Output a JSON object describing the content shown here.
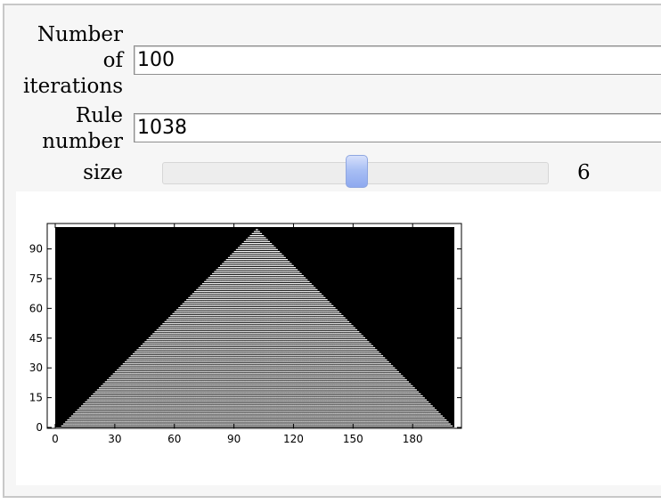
{
  "controls": {
    "iterations": {
      "label_lines": [
        "Number",
        "of",
        "iterations"
      ],
      "value": "100"
    },
    "rule": {
      "label_lines": [
        "Rule",
        "number"
      ],
      "value": "1038"
    },
    "size": {
      "label": "size",
      "value": "6",
      "level": 0.5
    }
  },
  "plot": {
    "x_ticks": [
      "0",
      "30",
      "60",
      "90",
      "120",
      "150",
      "180"
    ],
    "y_ticks": [
      "0",
      "15",
      "30",
      "45",
      "60",
      "75",
      "90"
    ],
    "colors": {
      "background": "#000000",
      "cell_on": "#ffffff",
      "cell_off": "#000000"
    }
  },
  "chart_data": {
    "type": "heatmap",
    "title": "",
    "xlabel": "",
    "ylabel": "",
    "xlim": [
      0,
      201
    ],
    "ylim": [
      0,
      101
    ],
    "iterations": 100,
    "rule": 1038,
    "x_ticks": [
      0,
      30,
      60,
      90,
      120,
      150,
      180
    ],
    "y_ticks": [
      0,
      15,
      30,
      45,
      60,
      75,
      90
    ],
    "grid": false,
    "legend": "none"
  }
}
